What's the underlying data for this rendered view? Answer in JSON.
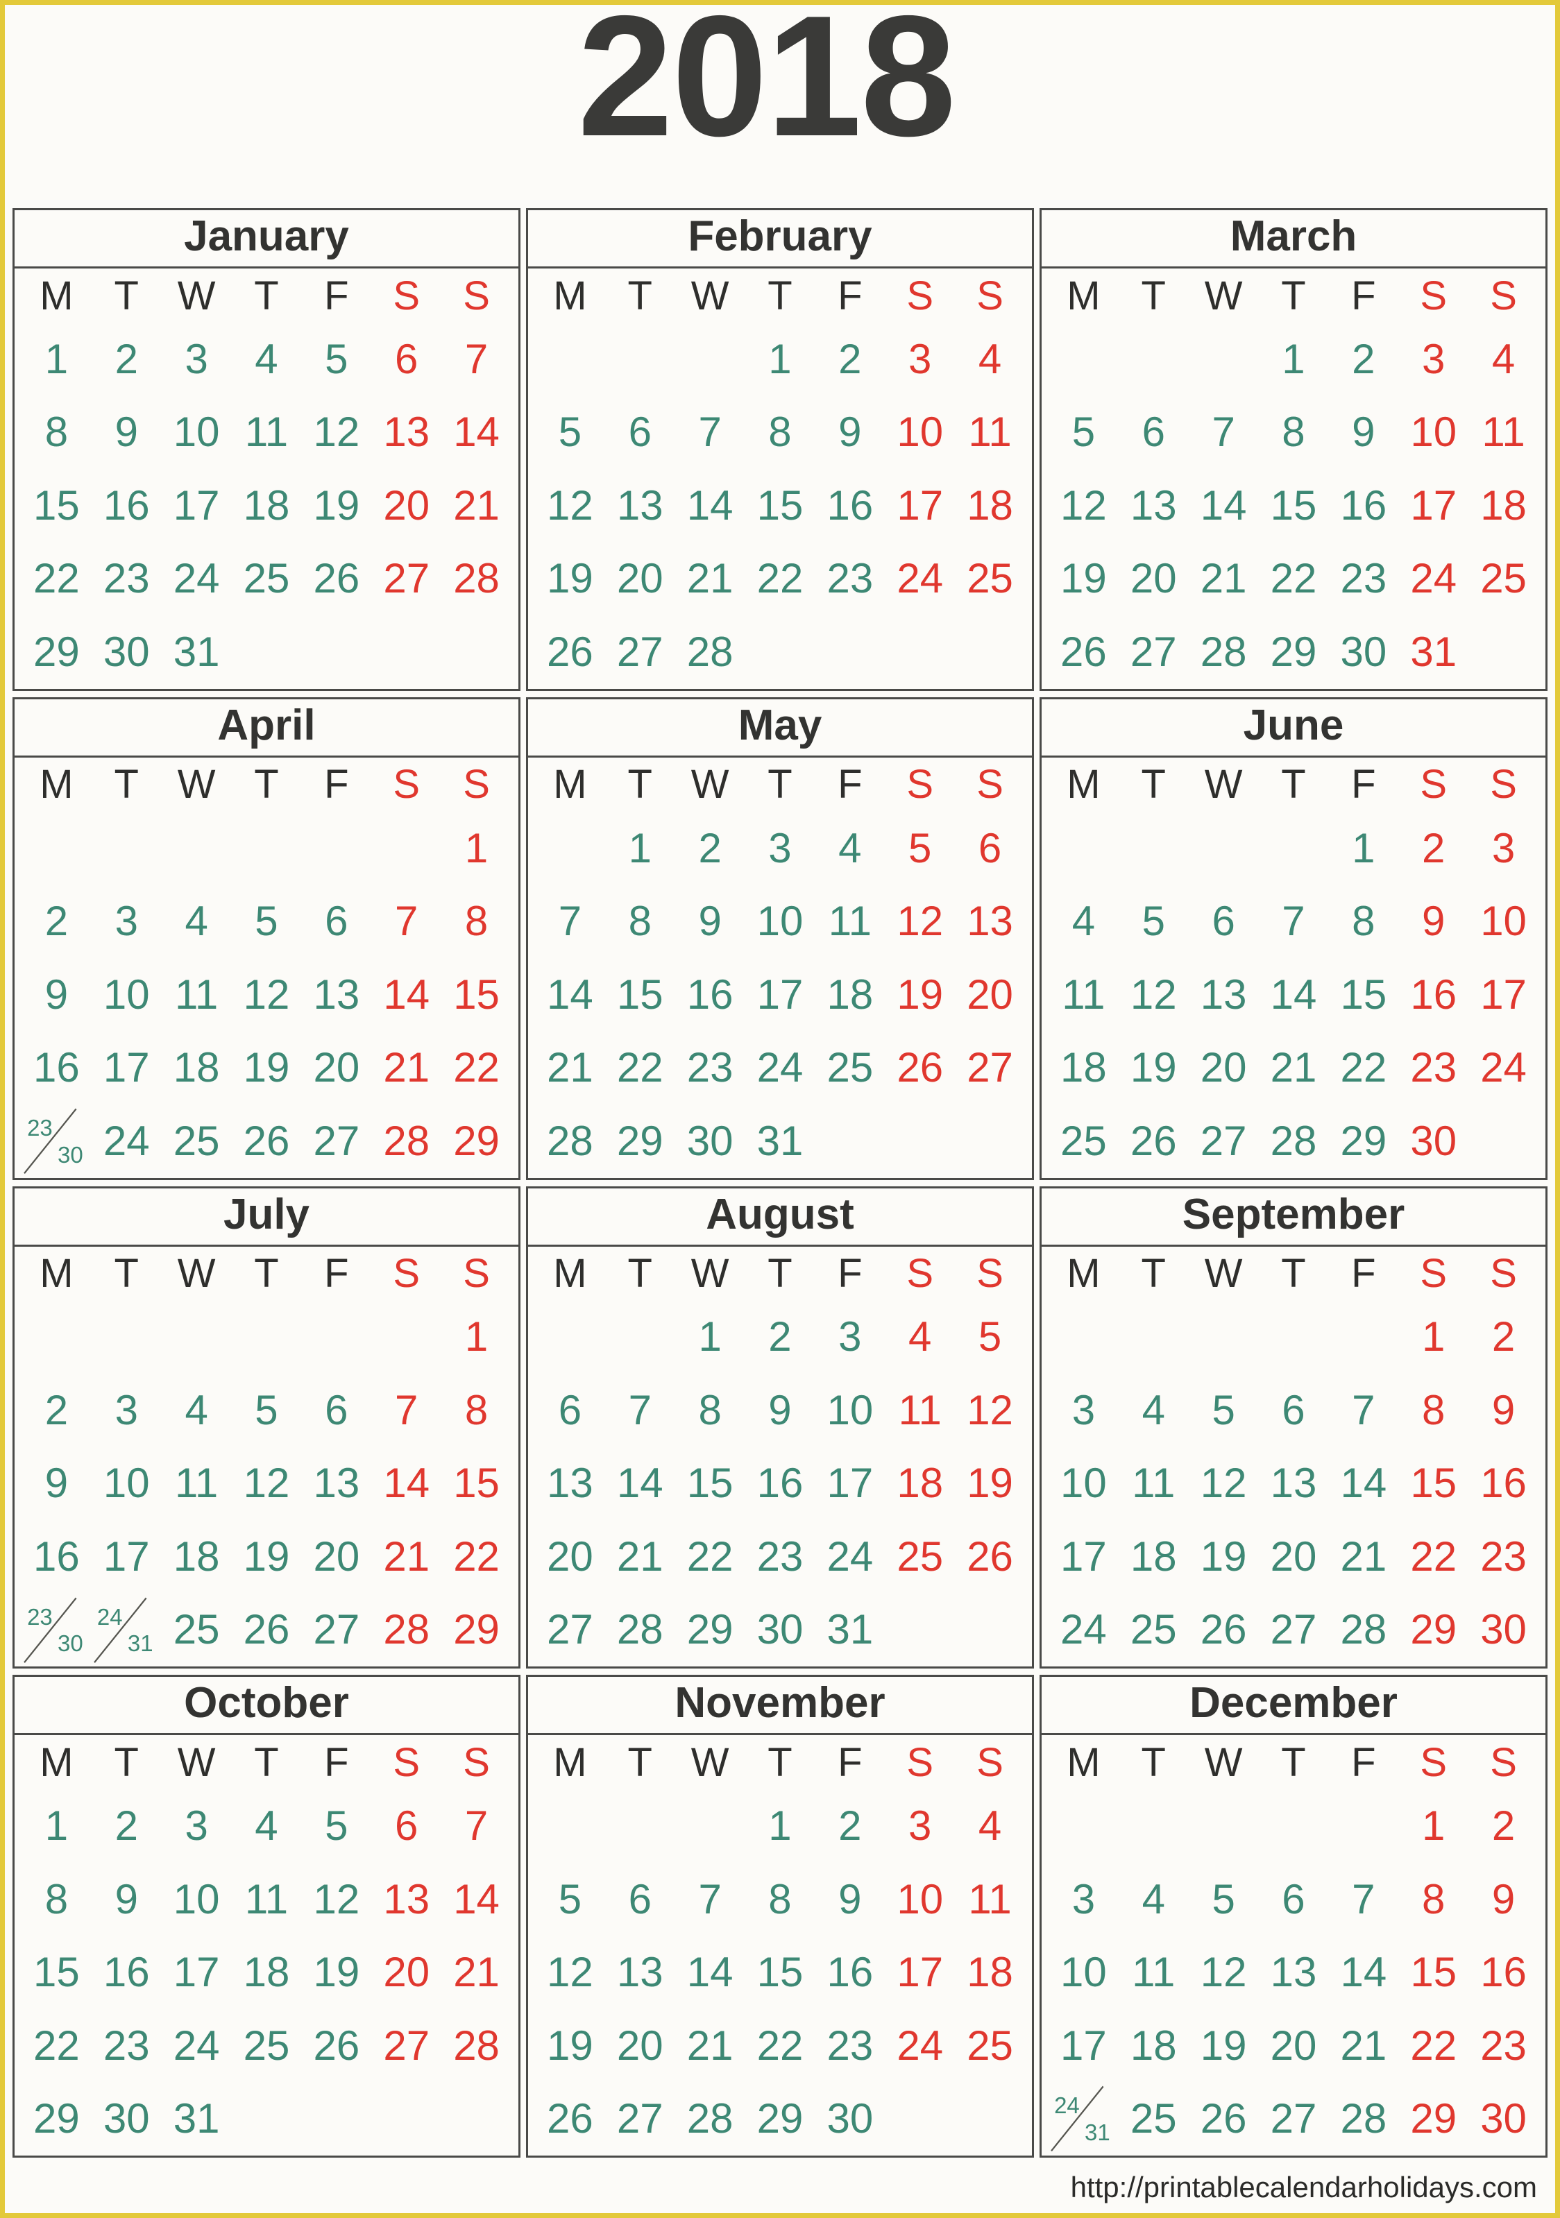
{
  "title": {
    "year": "2018"
  },
  "colors": {
    "frame": "#E3C93A",
    "weekday_number": "#3D8874",
    "weekend_number": "#E0372E",
    "month_name": "#333331",
    "page_background": "#FCFBF8",
    "cell_border": "#4A4A48"
  },
  "weekday_headers": [
    "M",
    "T",
    "W",
    "T",
    "F",
    "S",
    "S"
  ],
  "weekend_indices": [
    5,
    6
  ],
  "footer": {
    "url": "http://printablecalendarholidays.com"
  },
  "chart_data": {
    "type": "table",
    "title": "2018",
    "week_start": "Monday",
    "columns": [
      "M",
      "T",
      "W",
      "T",
      "F",
      "S",
      "S"
    ]
  },
  "months": [
    {
      "name": "January",
      "weeks": [
        [
          "1",
          "2",
          "3",
          "4",
          "5",
          "6",
          "7"
        ],
        [
          "8",
          "9",
          "10",
          "11",
          "12",
          "13",
          "14"
        ],
        [
          "15",
          "16",
          "17",
          "18",
          "19",
          "20",
          "21"
        ],
        [
          "22",
          "23",
          "24",
          "25",
          "26",
          "27",
          "28"
        ],
        [
          "29",
          "30",
          "31",
          "",
          "",
          "",
          ""
        ]
      ]
    },
    {
      "name": "February",
      "weeks": [
        [
          "",
          "",
          "",
          "1",
          "2",
          "3",
          "4"
        ],
        [
          "5",
          "6",
          "7",
          "8",
          "9",
          "10",
          "11"
        ],
        [
          "12",
          "13",
          "14",
          "15",
          "16",
          "17",
          "18"
        ],
        [
          "19",
          "20",
          "21",
          "22",
          "23",
          "24",
          "25"
        ],
        [
          "26",
          "27",
          "28",
          "",
          "",
          "",
          ""
        ]
      ]
    },
    {
      "name": "March",
      "weeks": [
        [
          "",
          "",
          "",
          "1",
          "2",
          "3",
          "4"
        ],
        [
          "5",
          "6",
          "7",
          "8",
          "9",
          "10",
          "11"
        ],
        [
          "12",
          "13",
          "14",
          "15",
          "16",
          "17",
          "18"
        ],
        [
          "19",
          "20",
          "21",
          "22",
          "23",
          "24",
          "25"
        ],
        [
          "26",
          "27",
          "28",
          "29",
          "30",
          "31",
          ""
        ]
      ]
    },
    {
      "name": "April",
      "weeks": [
        [
          "",
          "",
          "",
          "",
          "",
          "",
          "1"
        ],
        [
          "2",
          "3",
          "4",
          "5",
          "6",
          "7",
          "8"
        ],
        [
          "9",
          "10",
          "11",
          "12",
          "13",
          "14",
          "15"
        ],
        [
          "16",
          "17",
          "18",
          "19",
          "20",
          "21",
          "22"
        ],
        [
          "23/30",
          "24",
          "25",
          "26",
          "27",
          "28",
          "29"
        ]
      ]
    },
    {
      "name": "May",
      "weeks": [
        [
          "",
          "1",
          "2",
          "3",
          "4",
          "5",
          "6"
        ],
        [
          "7",
          "8",
          "9",
          "10",
          "11",
          "12",
          "13"
        ],
        [
          "14",
          "15",
          "16",
          "17",
          "18",
          "19",
          "20"
        ],
        [
          "21",
          "22",
          "23",
          "24",
          "25",
          "26",
          "27"
        ],
        [
          "28",
          "29",
          "30",
          "31",
          "",
          "",
          ""
        ]
      ]
    },
    {
      "name": "June",
      "weeks": [
        [
          "",
          "",
          "",
          "",
          "1",
          "2",
          "3"
        ],
        [
          "4",
          "5",
          "6",
          "7",
          "8",
          "9",
          "10"
        ],
        [
          "11",
          "12",
          "13",
          "14",
          "15",
          "16",
          "17"
        ],
        [
          "18",
          "19",
          "20",
          "21",
          "22",
          "23",
          "24"
        ],
        [
          "25",
          "26",
          "27",
          "28",
          "29",
          "30",
          ""
        ]
      ]
    },
    {
      "name": "July",
      "weeks": [
        [
          "",
          "",
          "",
          "",
          "",
          "",
          "1"
        ],
        [
          "2",
          "3",
          "4",
          "5",
          "6",
          "7",
          "8"
        ],
        [
          "9",
          "10",
          "11",
          "12",
          "13",
          "14",
          "15"
        ],
        [
          "16",
          "17",
          "18",
          "19",
          "20",
          "21",
          "22"
        ],
        [
          "23/30",
          "24/31",
          "25",
          "26",
          "27",
          "28",
          "29"
        ]
      ]
    },
    {
      "name": "August",
      "weeks": [
        [
          "",
          "",
          "1",
          "2",
          "3",
          "4",
          "5"
        ],
        [
          "6",
          "7",
          "8",
          "9",
          "10",
          "11",
          "12"
        ],
        [
          "13",
          "14",
          "15",
          "16",
          "17",
          "18",
          "19"
        ],
        [
          "20",
          "21",
          "22",
          "23",
          "24",
          "25",
          "26"
        ],
        [
          "27",
          "28",
          "29",
          "30",
          "31",
          "",
          ""
        ]
      ]
    },
    {
      "name": "September",
      "weeks": [
        [
          "",
          "",
          "",
          "",
          "",
          "1",
          "2"
        ],
        [
          "3",
          "4",
          "5",
          "6",
          "7",
          "8",
          "9"
        ],
        [
          "10",
          "11",
          "12",
          "13",
          "14",
          "15",
          "16"
        ],
        [
          "17",
          "18",
          "19",
          "20",
          "21",
          "22",
          "23"
        ],
        [
          "24",
          "25",
          "26",
          "27",
          "28",
          "29",
          "30"
        ]
      ]
    },
    {
      "name": "October",
      "weeks": [
        [
          "1",
          "2",
          "3",
          "4",
          "5",
          "6",
          "7"
        ],
        [
          "8",
          "9",
          "10",
          "11",
          "12",
          "13",
          "14"
        ],
        [
          "15",
          "16",
          "17",
          "18",
          "19",
          "20",
          "21"
        ],
        [
          "22",
          "23",
          "24",
          "25",
          "26",
          "27",
          "28"
        ],
        [
          "29",
          "30",
          "31",
          "",
          "",
          "",
          ""
        ]
      ]
    },
    {
      "name": "November",
      "weeks": [
        [
          "",
          "",
          "",
          "1",
          "2",
          "3",
          "4"
        ],
        [
          "5",
          "6",
          "7",
          "8",
          "9",
          "10",
          "11"
        ],
        [
          "12",
          "13",
          "14",
          "15",
          "16",
          "17",
          "18"
        ],
        [
          "19",
          "20",
          "21",
          "22",
          "23",
          "24",
          "25"
        ],
        [
          "26",
          "27",
          "28",
          "29",
          "30",
          "",
          ""
        ]
      ]
    },
    {
      "name": "December",
      "weeks": [
        [
          "",
          "",
          "",
          "",
          "",
          "1",
          "2"
        ],
        [
          "3",
          "4",
          "5",
          "6",
          "7",
          "8",
          "9"
        ],
        [
          "10",
          "11",
          "12",
          "13",
          "14",
          "15",
          "16"
        ],
        [
          "17",
          "18",
          "19",
          "20",
          "21",
          "22",
          "23"
        ],
        [
          "24/31",
          "25",
          "26",
          "27",
          "28",
          "29",
          "30"
        ]
      ]
    }
  ]
}
